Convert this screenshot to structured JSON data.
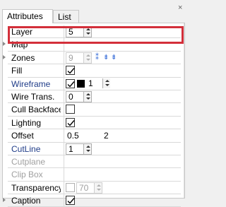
{
  "tabs": [
    {
      "label": "Attributes"
    },
    {
      "label": "List"
    }
  ],
  "close_glyph": "×",
  "properties": {
    "layer": {
      "label": "Layer",
      "value": "5"
    },
    "map": {
      "label": "Map"
    },
    "zones": {
      "label": "Zones",
      "value": "9"
    },
    "fill": {
      "label": "Fill",
      "checked": true
    },
    "wireframe": {
      "label": "Wireframe",
      "checked": true,
      "color": "#000000",
      "value": "1"
    },
    "wire_trans": {
      "label": "Wire Trans.",
      "value": "0"
    },
    "cull_backface": {
      "label": "Cull Backface",
      "checked": false
    },
    "lighting": {
      "label": "Lighting",
      "checked": true
    },
    "offset": {
      "label": "Offset",
      "value1": "0.5",
      "value2": "2"
    },
    "cutline": {
      "label": "CutLine",
      "value": "1"
    },
    "cutplane": {
      "label": "Cutplane"
    },
    "clip_box": {
      "label": "Clip Box"
    },
    "transparency": {
      "label": "Transparency",
      "checked": false,
      "value": "70"
    },
    "caption": {
      "label": "Caption",
      "checked": true
    }
  },
  "colors": {
    "highlight": "#d32f3a",
    "accent_label": "#1f3c88"
  }
}
